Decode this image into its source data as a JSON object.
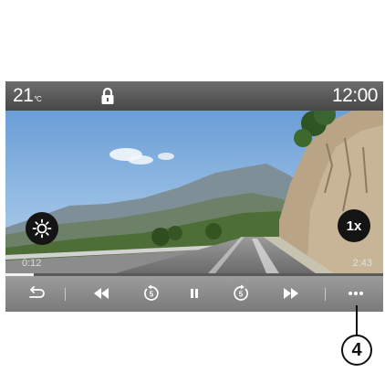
{
  "status": {
    "temperature": "21",
    "temperature_unit": "°C",
    "clock": "12:00"
  },
  "video": {
    "elapsed": "0:12",
    "total": "2:43",
    "progress_fraction": 0.074,
    "speed_label": "1x"
  },
  "controls": {
    "icons": [
      "back-icon",
      "rewind-icon",
      "skip-back-icon",
      "pause-icon",
      "skip-forward-icon",
      "fast-forward-icon",
      "more-options-icon"
    ]
  },
  "callout": {
    "number": "4"
  },
  "colors": {
    "status_bar": "#5a5a5a",
    "controls_bar": "#8a8a8a",
    "progress": "#f2f2f2"
  }
}
